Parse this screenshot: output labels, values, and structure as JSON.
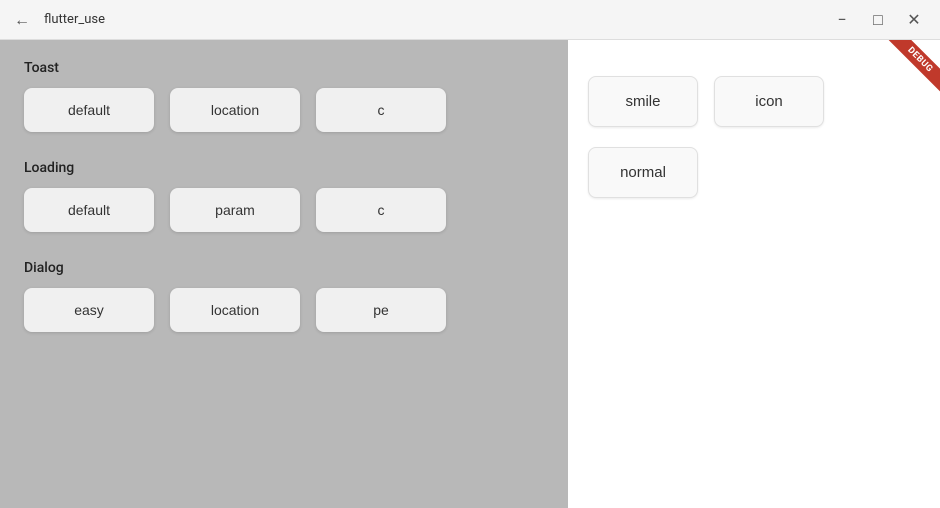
{
  "titlebar": {
    "title": "flutter_use",
    "back_icon": "←",
    "minimize_icon": "−",
    "maximize_icon": "□",
    "close_icon": "✕"
  },
  "left_panel": {
    "sections": [
      {
        "label": "Toast",
        "buttons": [
          "default",
          "location",
          "c"
        ]
      },
      {
        "label": "Loading",
        "buttons": [
          "default",
          "param",
          "c"
        ]
      },
      {
        "label": "Dialog",
        "buttons": [
          "easy",
          "location",
          "pe"
        ]
      }
    ]
  },
  "right_panel": {
    "debug_label": "DEBUG",
    "top_buttons": [
      "smile",
      "icon"
    ],
    "bottom_buttons": [
      "normal"
    ]
  }
}
